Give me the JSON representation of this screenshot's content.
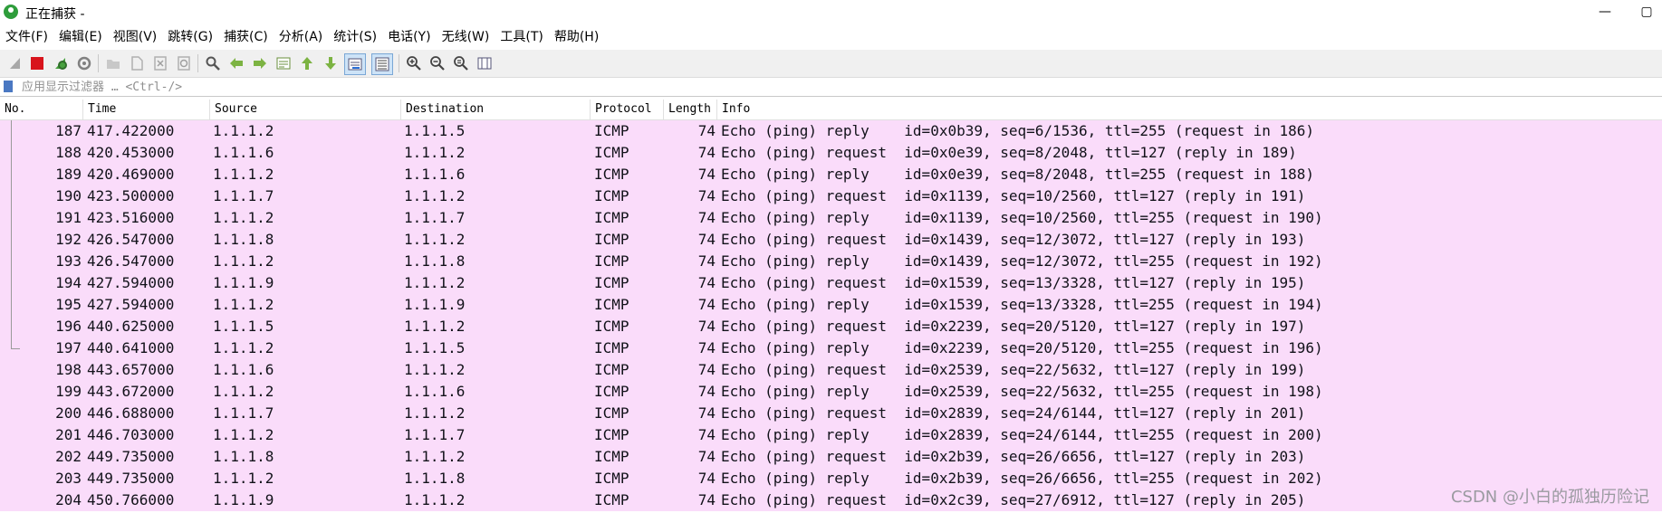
{
  "window": {
    "title": "正在捕获 -"
  },
  "menu": [
    "文件(F)",
    "编辑(E)",
    "视图(V)",
    "跳转(G)",
    "捕获(C)",
    "分析(A)",
    "统计(S)",
    "电话(Y)",
    "无线(W)",
    "工具(T)",
    "帮助(H)"
  ],
  "filter": {
    "placeholder": "应用显示过滤器 … <Ctrl-/>"
  },
  "columns": {
    "no": "No.",
    "time": "Time",
    "source": "Source",
    "destination": "Destination",
    "protocol": "Protocol",
    "length": "Length",
    "info": "Info"
  },
  "rows": [
    {
      "no": "187",
      "time": "417.422000",
      "src": "1.1.1.2",
      "dst": "1.1.1.5",
      "proto": "ICMP",
      "len": "74",
      "info": "Echo (ping) reply    id=0x0b39, seq=6/1536, ttl=255 (request in 186)"
    },
    {
      "no": "188",
      "time": "420.453000",
      "src": "1.1.1.6",
      "dst": "1.1.1.2",
      "proto": "ICMP",
      "len": "74",
      "info": "Echo (ping) request  id=0x0e39, seq=8/2048, ttl=127 (reply in 189)"
    },
    {
      "no": "189",
      "time": "420.469000",
      "src": "1.1.1.2",
      "dst": "1.1.1.6",
      "proto": "ICMP",
      "len": "74",
      "info": "Echo (ping) reply    id=0x0e39, seq=8/2048, ttl=255 (request in 188)"
    },
    {
      "no": "190",
      "time": "423.500000",
      "src": "1.1.1.7",
      "dst": "1.1.1.2",
      "proto": "ICMP",
      "len": "74",
      "info": "Echo (ping) request  id=0x1139, seq=10/2560, ttl=127 (reply in 191)"
    },
    {
      "no": "191",
      "time": "423.516000",
      "src": "1.1.1.2",
      "dst": "1.1.1.7",
      "proto": "ICMP",
      "len": "74",
      "info": "Echo (ping) reply    id=0x1139, seq=10/2560, ttl=255 (request in 190)"
    },
    {
      "no": "192",
      "time": "426.547000",
      "src": "1.1.1.8",
      "dst": "1.1.1.2",
      "proto": "ICMP",
      "len": "74",
      "info": "Echo (ping) request  id=0x1439, seq=12/3072, ttl=127 (reply in 193)"
    },
    {
      "no": "193",
      "time": "426.547000",
      "src": "1.1.1.2",
      "dst": "1.1.1.8",
      "proto": "ICMP",
      "len": "74",
      "info": "Echo (ping) reply    id=0x1439, seq=12/3072, ttl=255 (request in 192)"
    },
    {
      "no": "194",
      "time": "427.594000",
      "src": "1.1.1.9",
      "dst": "1.1.1.2",
      "proto": "ICMP",
      "len": "74",
      "info": "Echo (ping) request  id=0x1539, seq=13/3328, ttl=127 (reply in 195)"
    },
    {
      "no": "195",
      "time": "427.594000",
      "src": "1.1.1.2",
      "dst": "1.1.1.9",
      "proto": "ICMP",
      "len": "74",
      "info": "Echo (ping) reply    id=0x1539, seq=13/3328, ttl=255 (request in 194)"
    },
    {
      "no": "196",
      "time": "440.625000",
      "src": "1.1.1.5",
      "dst": "1.1.1.2",
      "proto": "ICMP",
      "len": "74",
      "info": "Echo (ping) request  id=0x2239, seq=20/5120, ttl=127 (reply in 197)"
    },
    {
      "no": "197",
      "time": "440.641000",
      "src": "1.1.1.2",
      "dst": "1.1.1.5",
      "proto": "ICMP",
      "len": "74",
      "info": "Echo (ping) reply    id=0x2239, seq=20/5120, ttl=255 (request in 196)"
    },
    {
      "no": "198",
      "time": "443.657000",
      "src": "1.1.1.6",
      "dst": "1.1.1.2",
      "proto": "ICMP",
      "len": "74",
      "info": "Echo (ping) request  id=0x2539, seq=22/5632, ttl=127 (reply in 199)"
    },
    {
      "no": "199",
      "time": "443.672000",
      "src": "1.1.1.2",
      "dst": "1.1.1.6",
      "proto": "ICMP",
      "len": "74",
      "info": "Echo (ping) reply    id=0x2539, seq=22/5632, ttl=255 (request in 198)"
    },
    {
      "no": "200",
      "time": "446.688000",
      "src": "1.1.1.7",
      "dst": "1.1.1.2",
      "proto": "ICMP",
      "len": "74",
      "info": "Echo (ping) request  id=0x2839, seq=24/6144, ttl=127 (reply in 201)"
    },
    {
      "no": "201",
      "time": "446.703000",
      "src": "1.1.1.2",
      "dst": "1.1.1.7",
      "proto": "ICMP",
      "len": "74",
      "info": "Echo (ping) reply    id=0x2839, seq=24/6144, ttl=255 (request in 200)"
    },
    {
      "no": "202",
      "time": "449.735000",
      "src": "1.1.1.8",
      "dst": "1.1.1.2",
      "proto": "ICMP",
      "len": "74",
      "info": "Echo (ping) request  id=0x2b39, seq=26/6656, ttl=127 (reply in 203)"
    },
    {
      "no": "203",
      "time": "449.735000",
      "src": "1.1.1.2",
      "dst": "1.1.1.8",
      "proto": "ICMP",
      "len": "74",
      "info": "Echo (ping) reply    id=0x2b39, seq=26/6656, ttl=255 (request in 202)"
    },
    {
      "no": "204",
      "time": "450.766000",
      "src": "1.1.1.9",
      "dst": "1.1.1.2",
      "proto": "ICMP",
      "len": "74",
      "info": "Echo (ping) request  id=0x2c39, seq=27/6912, ttl=127 (reply in 205)"
    }
  ],
  "row_color": "#fadcfa",
  "watermark": "CSDN @小白的孤独历险记",
  "toolbar_icons": [
    "shark-fin-start-icon",
    "stop-icon",
    "restart-icon",
    "options-gear-icon",
    "open-folder-icon",
    "save-file-icon",
    "close-file-icon",
    "reload-icon",
    "find-icon",
    "go-back-icon",
    "go-forward-icon",
    "go-to-packet-icon",
    "go-first-icon",
    "go-last-icon",
    "autoscroll-icon",
    "colorize-icon",
    "zoom-in-icon",
    "zoom-out-icon",
    "zoom-normal-icon",
    "resize-columns-icon"
  ]
}
